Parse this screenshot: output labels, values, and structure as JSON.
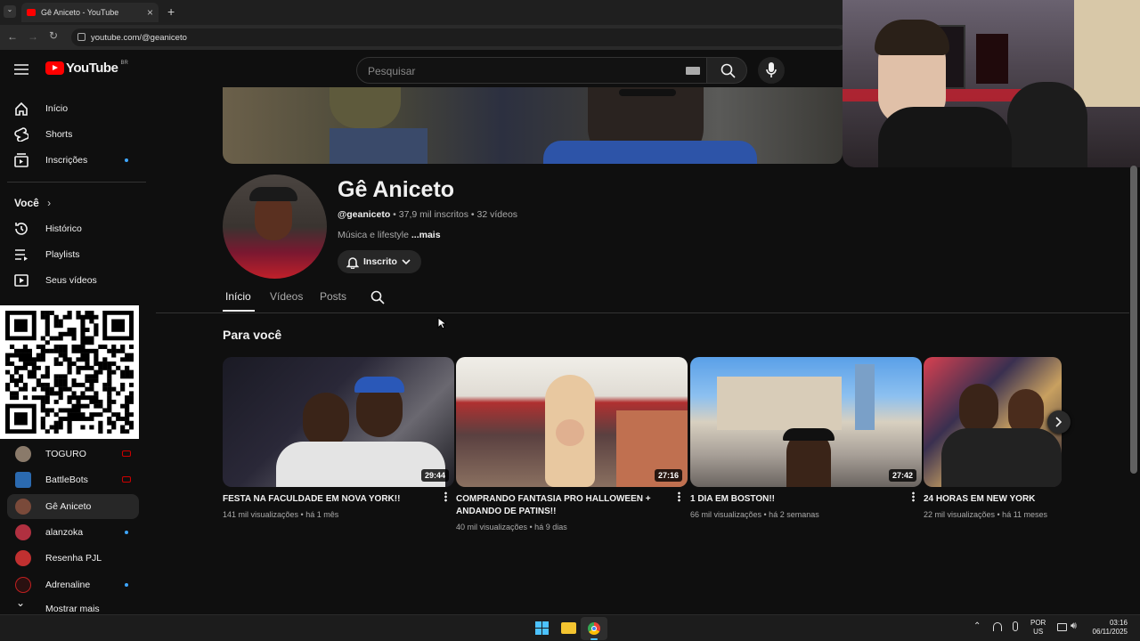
{
  "browser": {
    "tab_title": "Gê Aniceto - YouTube",
    "url": "youtube.com/@geaniceto",
    "new_tab": "+",
    "close": "×"
  },
  "header": {
    "logo": "YouTube",
    "region": "BR",
    "search_placeholder": "Pesquisar"
  },
  "sidebar": {
    "main": [
      {
        "label": "Início",
        "icon": "home-icon"
      },
      {
        "label": "Shorts",
        "icon": "shorts-icon"
      },
      {
        "label": "Inscrições",
        "icon": "subscriptions-icon",
        "dot": true
      }
    ],
    "you_title": "Você",
    "you": [
      {
        "label": "Histórico",
        "icon": "history-icon"
      },
      {
        "label": "Playlists",
        "icon": "playlist-icon"
      },
      {
        "label": "Seus vídeos",
        "icon": "your-videos-icon"
      }
    ],
    "subs": [
      {
        "label": "TOGURO",
        "color": "#8a7a6a",
        "live": true
      },
      {
        "label": "BattleBots",
        "color": "#2b6ab0",
        "live": true
      },
      {
        "label": "Gê Aniceto",
        "color": "#7a4a3a",
        "active": true
      },
      {
        "label": "alanzoka",
        "color": "#b03040",
        "dot": true
      },
      {
        "label": "Resenha PJL",
        "color": "#c03030"
      },
      {
        "label": "Adrenaline",
        "color": "#c02020",
        "dot": true
      }
    ],
    "more": "Mostrar mais"
  },
  "channel": {
    "name": "Gê Aniceto",
    "handle": "@geaniceto",
    "subscribers": "37,9 mil inscritos",
    "videos": "32 vídeos",
    "description": "Música e lifestyle",
    "more": "...mais",
    "subscribe_label": "Inscrito"
  },
  "tabs": [
    "Início",
    "Vídeos",
    "Posts"
  ],
  "section_title": "Para você",
  "videos": [
    {
      "title": "FESTA NA FACULDADE EM NOVA YORK!!",
      "meta": "141 mil visualizações • há 1 mês",
      "duration": "29:44"
    },
    {
      "title": "COMPRANDO FANTASIA PRO HALLOWEEN + ANDANDO DE PATINS!!",
      "meta": "40 mil visualizações • há 9 dias",
      "duration": "27:16"
    },
    {
      "title": "1 DIA EM BOSTON!!",
      "meta": "66 mil visualizações • há 2 semanas",
      "duration": "27:42"
    },
    {
      "title": "24 HORAS EM NEW YORK",
      "meta": "22 mil visualizações • há 11 meses",
      "duration": ""
    }
  ],
  "taskbar": {
    "lang": "POR",
    "layout": "US",
    "time": "03:16",
    "date": "06/11/2025"
  }
}
